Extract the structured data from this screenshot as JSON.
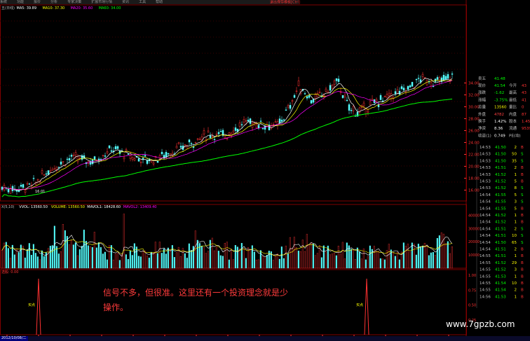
{
  "menu": [
    "系统",
    "功能",
    "报价",
    "分析",
    "专家决策",
    "扩展市场行情",
    "资讯",
    "工具",
    "帮助"
  ],
  "alert_text": "退出保存模板[Ctrl]",
  "price_header": {
    "label": "五(日线)",
    "ma5": "MA5: 39.89",
    "ma10": "MA10: 37.30",
    "ma20": "MA20: 35.60",
    "ma60": "MA60: 34.00"
  },
  "price_axis": [
    "34.00",
    "32.00",
    "30.00",
    "28.00",
    "26.00",
    "24.00",
    "22.00",
    "20.00",
    "18.00",
    "16.00"
  ],
  "low_marker": "16.01",
  "volume_header": {
    "label": "X(5,10)",
    "vvol": "VVOL: 13560.50",
    "volume": "VOLUME: 13560.50",
    "mavol1": "MAVOL1: 18428.60",
    "mavol2": "MAVOL2: 13409.40"
  },
  "volume_axis": [
    "40000",
    "30000",
    "20000",
    "10000"
  ],
  "signal_header": "选股: 0.00",
  "signal_axis": [
    "1.00",
    "0.75",
    "0.50",
    "0.25"
  ],
  "signal_labels": [
    "买点",
    "买点"
  ],
  "annotation": "信号不多，但很准。这里还有一个投资理念就是少操作。",
  "date_label": "2012/10/08/二",
  "x_ticks": [
    "12",
    "1",
    "2",
    "3",
    "4",
    "5",
    "6",
    "7",
    "8",
    "9",
    "10",
    "11",
    "12",
    "1",
    "2"
  ],
  "watermark": "www.7gpzb.com",
  "quote": [
    {
      "k": "卖五",
      "v": "41.48",
      "c": "#00ff00"
    },
    {
      "k": "现价",
      "v": "41.54",
      "k2": "今开",
      "v2": "43",
      "c": "#00ff00"
    },
    {
      "k": "涨跌",
      "v": "-1.62",
      "k2": "最高",
      "v2": "43",
      "c": "#00ff00"
    },
    {
      "k": "涨幅",
      "v": "-3.75%",
      "k2": "最低",
      "v2": "41",
      "c": "#00ff00"
    },
    {
      "k": "总量",
      "v": "13560",
      "k2": "量比",
      "v2": "0",
      "c": "#ffff00"
    },
    {
      "k": "外盘",
      "v": "4782",
      "k2": "内盘",
      "v2": "87",
      "c": "#ff4040"
    },
    {
      "k": "换手",
      "v": "1.42%",
      "k2": "股本",
      "v2": "1.45",
      "c": "#ffffff"
    },
    {
      "k": "净资",
      "v": "8.36",
      "k2": "流通",
      "v2": "9539",
      "c": "#ffffff"
    },
    {
      "k": "收益(1)",
      "v": "0.749",
      "k2": "PE(动)",
      "v2": "",
      "c": "#ffffff"
    }
  ],
  "ticks": [
    {
      "t": "14:53",
      "p": "41.50",
      "v": "2",
      "s": "B"
    },
    {
      "t": "14:53",
      "p": "41.50",
      "v": "50",
      "s": "S"
    },
    {
      "t": "14:53",
      "p": "41.50",
      "v": "35",
      "s": "S"
    },
    {
      "t": "14:53",
      "p": "41.51",
      "v": "2",
      "s": "B"
    },
    {
      "t": "14:53",
      "p": "41.52",
      "v": "1",
      "s": "B"
    },
    {
      "t": "14:53",
      "p": "41.52",
      "v": "5",
      "s": "B"
    },
    {
      "t": "14:53",
      "p": "41.52",
      "v": "8",
      "s": "S"
    },
    {
      "t": "14:54",
      "p": "41.55",
      "v": "5",
      "s": "S"
    },
    {
      "t": "14:54",
      "p": "41.55",
      "v": "3",
      "s": "S"
    },
    {
      "t": "14:54",
      "p": "41.55",
      "v": "5",
      "s": "B"
    },
    {
      "t": "14:54",
      "p": "41.52",
      "v": "1",
      "s": "B"
    },
    {
      "t": "14:54",
      "p": "41.52",
      "v": "1",
      "s": "B"
    },
    {
      "t": "14:54",
      "p": "41.51",
      "v": "2",
      "s": "S"
    },
    {
      "t": "14:54",
      "p": "41.51",
      "v": "10",
      "s": "S"
    },
    {
      "t": "14:54",
      "p": "41.50",
      "v": "65",
      "s": "S"
    },
    {
      "t": "14:54",
      "p": "41.51",
      "v": "2",
      "s": "B"
    },
    {
      "t": "14:55",
      "p": "41.51",
      "v": "1",
      "s": "B"
    },
    {
      "t": "14:55",
      "p": "41.52",
      "v": "29",
      "s": "B"
    },
    {
      "t": "14:55",
      "p": "41.52",
      "v": "3",
      "s": "B"
    },
    {
      "t": "14:55",
      "p": "41.53",
      "v": "1",
      "s": "B"
    },
    {
      "t": "14:55",
      "p": "41.54",
      "v": "10",
      "s": "B"
    },
    {
      "t": "14:55",
      "p": "41.54",
      "v": "2",
      "s": "B"
    },
    {
      "t": "14:56",
      "p": "41.53",
      "v": "1",
      "s": "B"
    }
  ],
  "colors": {
    "up": "#ff3232",
    "down": "#54ffff",
    "ma5": "#ffffff",
    "ma10": "#ffff00",
    "ma20": "#ff00ff",
    "ma60": "#00ff00",
    "grid": "#800000"
  }
}
